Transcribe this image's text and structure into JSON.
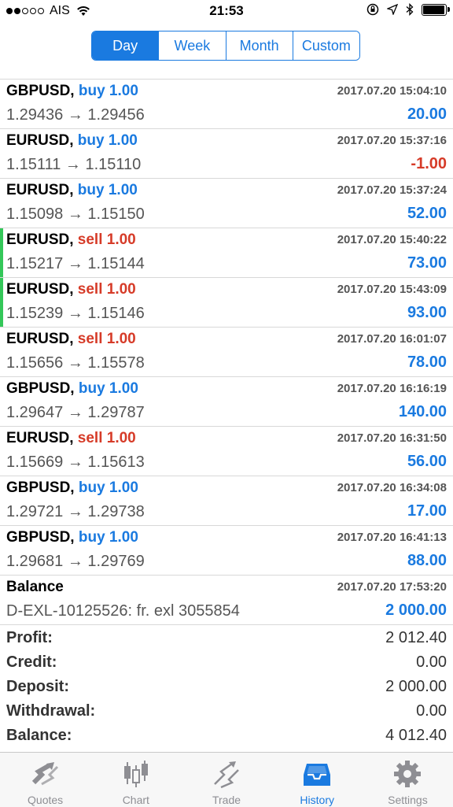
{
  "status_bar": {
    "carrier": "AIS",
    "time": "21:53",
    "battery_level": 0.9
  },
  "period_tabs": [
    {
      "label": "Day",
      "active": true
    },
    {
      "label": "Week",
      "active": false
    },
    {
      "label": "Month",
      "active": false
    },
    {
      "label": "Custom",
      "active": false
    }
  ],
  "deals": [
    {
      "symbol": "GBPUSD,",
      "side": "buy 1.00",
      "type": "buy",
      "time": "2017.07.20 15:04:10",
      "prices": "1.29436 → 1.29456",
      "profit": "20.00"
    },
    {
      "symbol": "EURUSD,",
      "side": "buy 1.00",
      "type": "buy",
      "time": "2017.07.20 15:37:16",
      "prices": "1.15111 → 1.15110",
      "profit": "-1.00"
    },
    {
      "symbol": "EURUSD,",
      "side": "buy 1.00",
      "type": "buy",
      "time": "2017.07.20 15:37:24",
      "prices": "1.15098 → 1.15150",
      "profit": "52.00"
    },
    {
      "symbol": "EURUSD,",
      "side": "sell 1.00",
      "type": "sell",
      "time": "2017.07.20 15:40:22",
      "prices": "1.15217 → 1.15144",
      "profit": "73.00"
    },
    {
      "symbol": "EURUSD,",
      "side": "sell 1.00",
      "type": "sell",
      "time": "2017.07.20 15:43:09",
      "prices": "1.15239 → 1.15146",
      "profit": "93.00"
    },
    {
      "symbol": "EURUSD,",
      "side": "sell 1.00",
      "type": "sell",
      "time": "2017.07.20 16:01:07",
      "prices": "1.15656 → 1.15578",
      "profit": "78.00"
    },
    {
      "symbol": "GBPUSD,",
      "side": "buy 1.00",
      "type": "buy",
      "time": "2017.07.20 16:16:19",
      "prices": "1.29647 → 1.29787",
      "profit": "140.00"
    },
    {
      "symbol": "EURUSD,",
      "side": "sell 1.00",
      "type": "sell",
      "time": "2017.07.20 16:31:50",
      "prices": "1.15669 → 1.15613",
      "profit": "56.00"
    },
    {
      "symbol": "GBPUSD,",
      "side": "buy 1.00",
      "type": "buy",
      "time": "2017.07.20 16:34:08",
      "prices": "1.29721 → 1.29738",
      "profit": "17.00"
    },
    {
      "symbol": "GBPUSD,",
      "side": "buy 1.00",
      "type": "buy",
      "time": "2017.07.20 16:41:13",
      "prices": "1.29681 → 1.29769",
      "profit": "88.00"
    },
    {
      "symbol": "Balance",
      "side": "",
      "type": "balance",
      "time": "2017.07.20 17:53:20",
      "prices": "D-EXL-10125526: fr. exl 3055854",
      "profit": "2 000.00"
    }
  ],
  "summary": {
    "profit_label": "Profit:",
    "profit_value": "2 012.40",
    "credit_label": "Credit:",
    "credit_value": "0.00",
    "deposit_label": "Deposit:",
    "deposit_value": "2 000.00",
    "withdrawal_label": "Withdrawal:",
    "withdrawal_value": "0.00",
    "balance_label": "Balance:",
    "balance_value": "4 012.40"
  },
  "tab_bar": [
    {
      "label": "Quotes",
      "icon": "quotes-icon",
      "active": false
    },
    {
      "label": "Chart",
      "icon": "candlestick-chart-icon",
      "active": false
    },
    {
      "label": "Trade",
      "icon": "trade-icon",
      "active": false
    },
    {
      "label": "History",
      "icon": "inbox-tray-icon",
      "active": true
    },
    {
      "label": "Settings",
      "icon": "gear-icon",
      "active": false
    }
  ],
  "colors": {
    "accent": "#1a7ae0",
    "sell": "#d63b28",
    "marker": "#34c759"
  }
}
